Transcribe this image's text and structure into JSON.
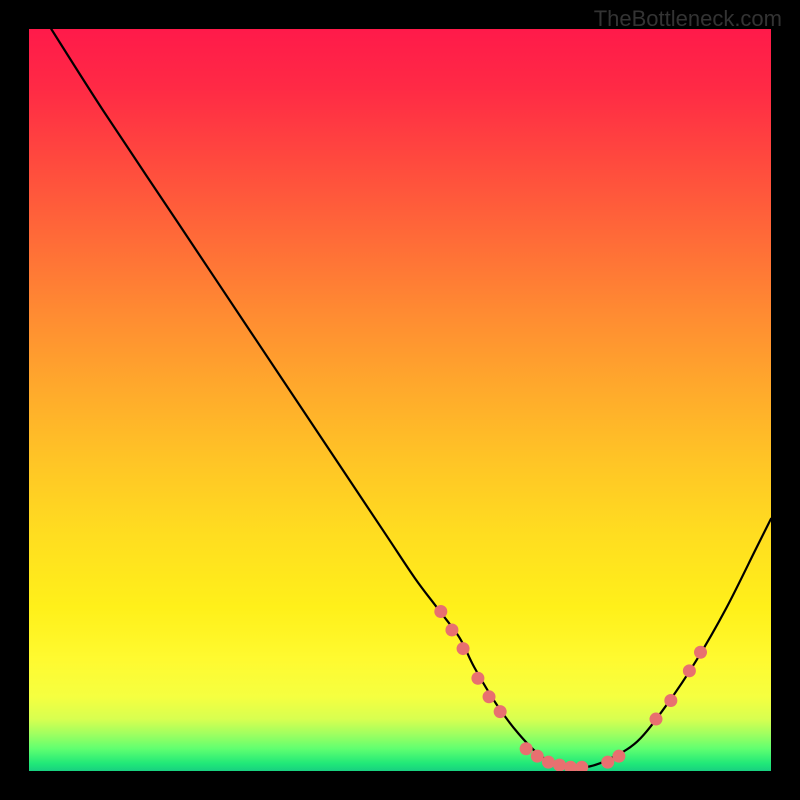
{
  "watermark": "TheBottleneck.com",
  "chart_data": {
    "type": "line",
    "title": "",
    "xlabel": "",
    "ylabel": "",
    "xlim": [
      0,
      100
    ],
    "ylim": [
      0,
      100
    ],
    "series": [
      {
        "name": "curve",
        "x": [
          3,
          10,
          20,
          30,
          40,
          48,
          52,
          55,
          58,
          60,
          63,
          66,
          69,
          72,
          75,
          78,
          82,
          86,
          90,
          94,
          98,
          100
        ],
        "y": [
          100,
          89,
          74,
          59,
          44,
          32,
          26,
          22,
          18,
          14,
          9,
          5,
          2,
          0.5,
          0.5,
          1.5,
          4,
          9,
          15,
          22,
          30,
          34
        ]
      }
    ],
    "markers": [
      {
        "x": 55.5,
        "y": 21.5
      },
      {
        "x": 57.0,
        "y": 19.0
      },
      {
        "x": 58.5,
        "y": 16.5
      },
      {
        "x": 60.5,
        "y": 12.5
      },
      {
        "x": 62.0,
        "y": 10.0
      },
      {
        "x": 63.5,
        "y": 8.0
      },
      {
        "x": 67.0,
        "y": 3.0
      },
      {
        "x": 68.5,
        "y": 2.0
      },
      {
        "x": 70.0,
        "y": 1.2
      },
      {
        "x": 71.5,
        "y": 0.8
      },
      {
        "x": 73.0,
        "y": 0.5
      },
      {
        "x": 74.5,
        "y": 0.5
      },
      {
        "x": 78.0,
        "y": 1.2
      },
      {
        "x": 79.5,
        "y": 2.0
      },
      {
        "x": 84.5,
        "y": 7.0
      },
      {
        "x": 86.5,
        "y": 9.5
      },
      {
        "x": 89.0,
        "y": 13.5
      },
      {
        "x": 90.5,
        "y": 16.0
      }
    ],
    "gradient_stops": [
      {
        "pos": 0,
        "color": "#ff1a4a"
      },
      {
        "pos": 50,
        "color": "#ffb828"
      },
      {
        "pos": 85,
        "color": "#fffa30"
      },
      {
        "pos": 100,
        "color": "#18d080"
      }
    ]
  }
}
